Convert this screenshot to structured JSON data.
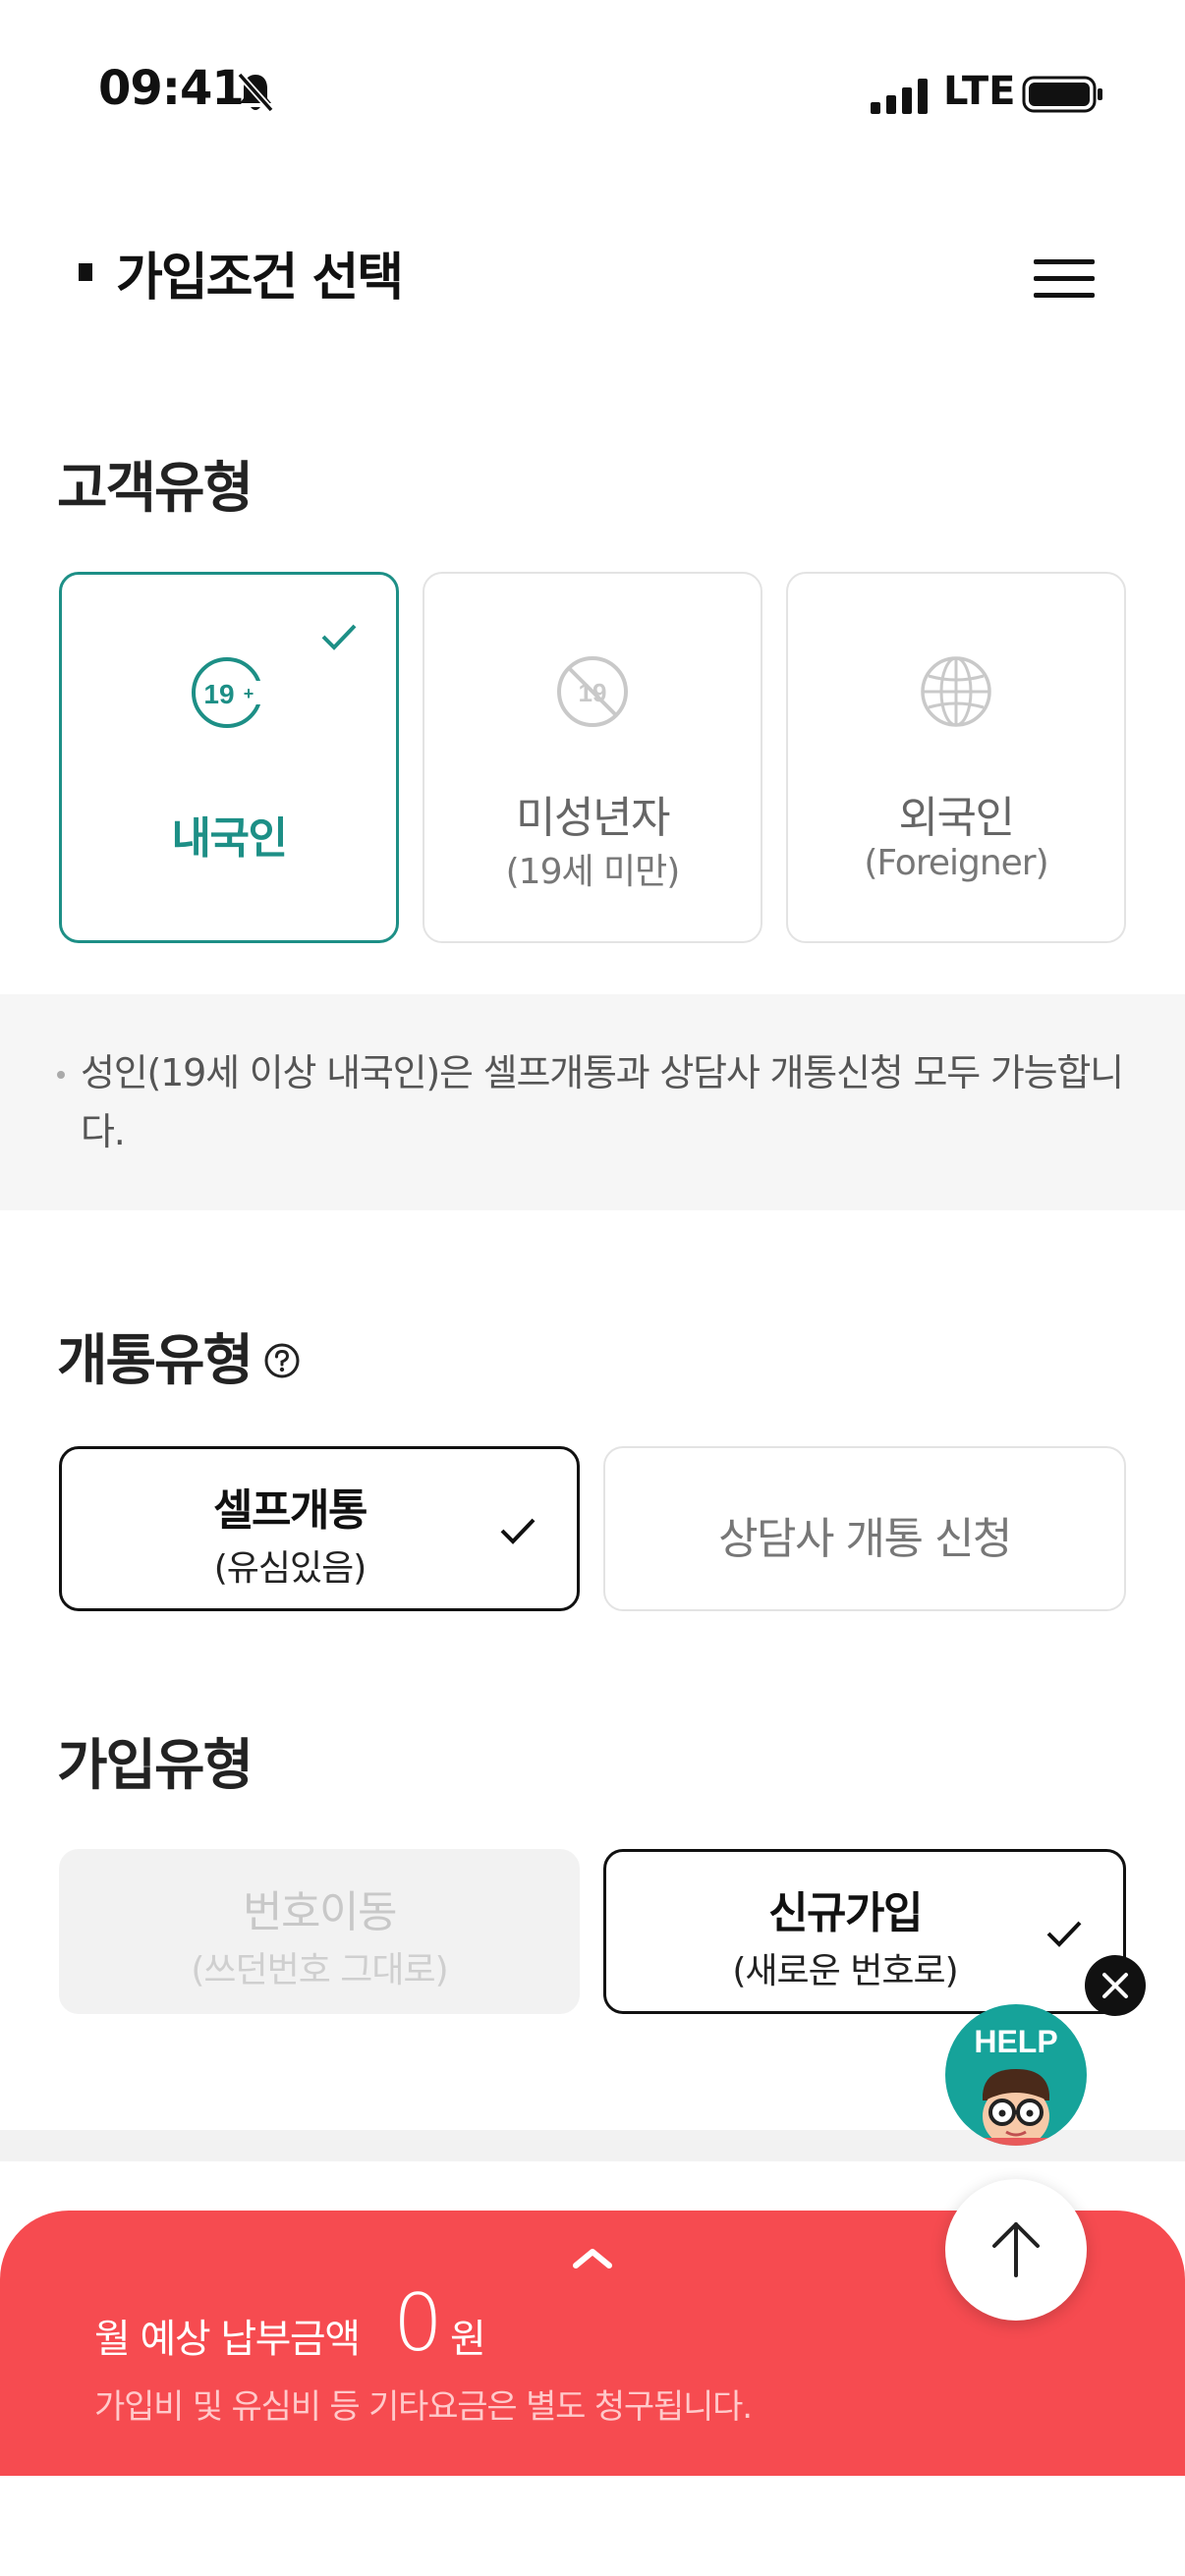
{
  "status_bar": {
    "time": "09:41",
    "network": "LTE"
  },
  "header": {
    "title": "가입조건 선택"
  },
  "customer_type": {
    "heading": "고객유형",
    "options": [
      {
        "label": "내국인",
        "sub": "",
        "icon": "adult-19plus-icon",
        "selected": true
      },
      {
        "label": "미성년자",
        "sub": "(19세 미만)",
        "icon": "no-19-icon",
        "selected": false
      },
      {
        "label": "외국인",
        "sub": "(Foreigner)",
        "icon": "globe-icon",
        "selected": false
      }
    ],
    "icon_text": {
      "adult": "19",
      "minor": "19"
    },
    "notice": "성인(19세 이상 내국인)은 셀프개통과 상담사 개통신청 모두 가능합니다."
  },
  "activation_type": {
    "heading": "개통유형",
    "options": [
      {
        "label": "셀프개통",
        "sub": "(유심있음)",
        "selected": true
      },
      {
        "label": "상담사 개통 신청",
        "sub": "",
        "selected": false
      }
    ]
  },
  "join_type": {
    "heading": "가입유형",
    "options": [
      {
        "label": "번호이동",
        "sub": "(쓰던번호 그대로)",
        "selected": false,
        "disabled": true
      },
      {
        "label": "신규가입",
        "sub": "(새로운 번호로)",
        "selected": true,
        "disabled": false
      }
    ]
  },
  "help_button": {
    "label": "HELP"
  },
  "bottom_bar": {
    "label": "월 예상 납부금액",
    "amount": "0",
    "unit": "원",
    "note": "가입비 및 유심비 등 기타요금은 별도 청구됩니다."
  },
  "colors": {
    "teal": "#1d8f86",
    "accent_red": "#f64b50",
    "help_teal": "#16a39a"
  }
}
